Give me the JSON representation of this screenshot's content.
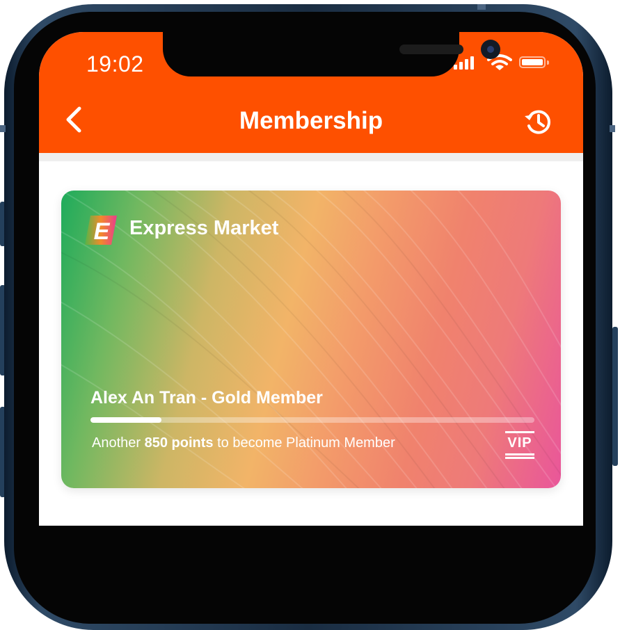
{
  "status_bar": {
    "time": "19:02",
    "signal_icon": "cellular-signal-icon",
    "wifi_icon": "wifi-icon",
    "battery_icon": "battery-icon",
    "battery_level": 1.0
  },
  "nav": {
    "title": "Membership",
    "back_icon": "chevron-left-icon",
    "history_icon": "history-icon"
  },
  "card": {
    "brand_logo_letter": "E",
    "brand_name": "Express Market",
    "member_line": "Alex An Tran - Gold Member",
    "progress": 0.16,
    "points_prefix": "Another ",
    "points_value": "850 points",
    "points_suffix": " to become Platinum Member",
    "badge": "VIP"
  },
  "colors": {
    "header_bg": "#fe5000",
    "card_gradient_start": "#1eab5b",
    "card_gradient_mid": "#f2b468",
    "card_gradient_end": "#e9569a",
    "text_on_color": "#ffffff"
  }
}
